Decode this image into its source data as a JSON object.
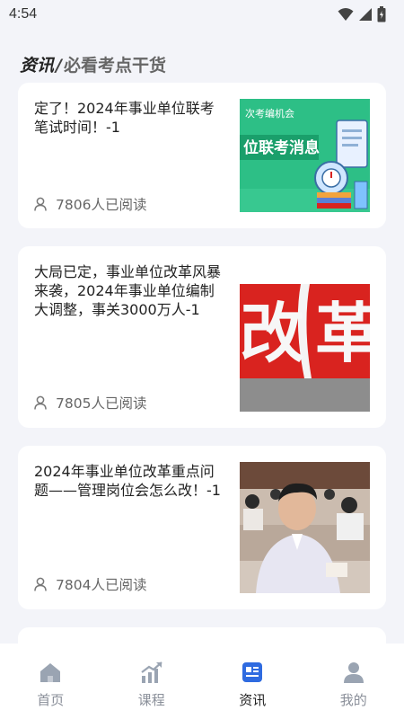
{
  "status_bar": {
    "time": "4:54"
  },
  "section": {
    "title": "资讯",
    "separator": "/",
    "subtitle": "必看考点干货"
  },
  "articles": [
    {
      "title": "定了！2024年事业单位联考笔试时间！-1",
      "reads": "7806人已阅读",
      "thumb_text": [
        "次考编机会",
        "位联考消息"
      ]
    },
    {
      "title": "大局已定，事业单位改革风暴来袭，2024年事业单位编制大调整，事关3000万人-1",
      "reads": "7805人已阅读",
      "thumb_text": [
        "改",
        "革"
      ]
    },
    {
      "title": "2024年事业单位改革重点问题——管理岗位会怎么改！-1",
      "reads": "7804人已阅读"
    }
  ],
  "nav": {
    "items": [
      {
        "label": "首页",
        "icon": "home-icon"
      },
      {
        "label": "课程",
        "icon": "chart-icon"
      },
      {
        "label": "资讯",
        "icon": "news-icon"
      },
      {
        "label": "我的",
        "icon": "profile-icon"
      }
    ],
    "active": "资讯"
  },
  "colors": {
    "accent": "#2f6be0",
    "green": "#2dbf86",
    "red": "#d9231f",
    "inactive": "#9aa4b2"
  }
}
